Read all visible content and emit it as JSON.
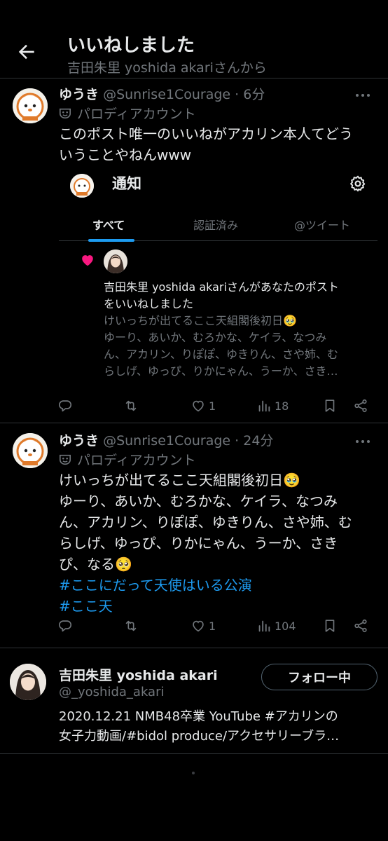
{
  "header": {
    "title": "いいねしました",
    "subtitle": "吉田朱里 yoshida akariさんから"
  },
  "tweets": [
    {
      "name": "ゆうき",
      "handle": "@Sunrise1Courage",
      "time": "· 6分",
      "badge": "パロディアカウント",
      "lines": [
        "このポスト唯一のいいねがアカリン本人てどう",
        "いうことやねんwww"
      ],
      "embed": {
        "title": "通知",
        "tabs": [
          "すべて",
          "認証済み",
          "@ツイート"
        ],
        "main_lines": [
          "吉田朱里 yoshida akariさんがあなたのポスト",
          "をいいねしました"
        ],
        "quote_lines": [
          "けいっちが出てるここ天組閣後初日🥹",
          "ゆーり、あいか、むろかな、ケイラ、なつみ",
          "ん、アカリン、りぽぽ、ゆきりん、さや姉、む",
          "らしげ、ゆっぴ、りかにゃん、うーか、さき…"
        ]
      },
      "actions": {
        "replies": "",
        "retweets": "",
        "likes": "1",
        "views": "18"
      }
    },
    {
      "name": "ゆうき",
      "handle": "@Sunrise1Courage",
      "time": "· 24分",
      "badge": "パロディアカウント",
      "lines": [
        "けいっちが出てるここ天組閣後初日🥹",
        "ゆーり、あいか、むろかな、ケイラ、なつみ",
        "ん、アカリン、りぽぽ、ゆきりん、さや姉、む",
        "らしげ、ゆっぴ、りかにゃん、うーか、さき",
        "ぴ、なる🥺"
      ],
      "hashtags": [
        "#ここにだって天使はいる公演",
        "#ここ天"
      ],
      "actions": {
        "replies": "",
        "retweets": "",
        "likes": "1",
        "views": "104"
      }
    }
  ],
  "profile": {
    "name": "吉田朱里 yoshida akari",
    "handle": "@_yoshida_akari",
    "follow_label": "フォロー中",
    "bio_lines": [
      "2020.12.21 NMB48卒業 YouTube #アカリンの",
      "女子力動画/#bidol produce/アクセサリーブラ…"
    ]
  },
  "icons": {
    "back": "arrow-left-icon",
    "more": "more-dots-icon",
    "parody": "theater-mask-icon",
    "reply": "reply-icon",
    "retweet": "retweet-icon",
    "like": "heart-outline-icon",
    "views": "views-chart-icon",
    "bookmark": "bookmark-icon",
    "share": "share-icon",
    "settings": "gear-icon",
    "liked": "heart-filled-icon"
  },
  "colors": {
    "accent": "#1d9bf0",
    "like": "#f91880",
    "muted": "#71767b",
    "text": "#e7e9ea",
    "background": "#000000"
  }
}
